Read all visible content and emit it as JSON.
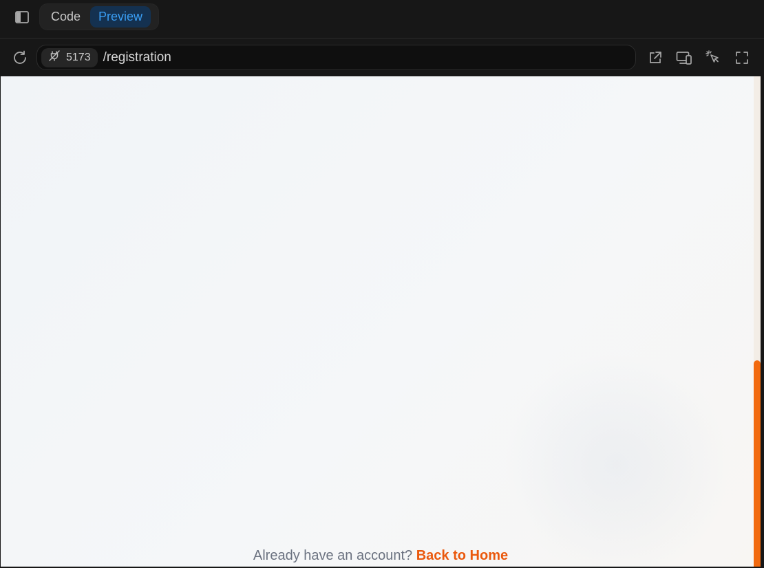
{
  "toolbar": {
    "tabs": [
      {
        "label": "Code",
        "active": false
      },
      {
        "label": "Preview",
        "active": true
      }
    ]
  },
  "address": {
    "port": "5173",
    "path": "/registration"
  },
  "page": {
    "footer_prefix": "Already have an account?",
    "footer_link": "Back to Home"
  },
  "colors": {
    "accent_tab": "#3a9ef4",
    "link": "#ea580c",
    "scroll_thumb": "#f26a0f"
  },
  "icons": {
    "sidebar_toggle": "sidebar-toggle-icon",
    "reload": "reload-icon",
    "port": "plug-off-icon",
    "open_external": "external-link-icon",
    "devices": "devices-icon",
    "inspect": "cursor-select-icon",
    "fullscreen": "fullscreen-icon"
  }
}
